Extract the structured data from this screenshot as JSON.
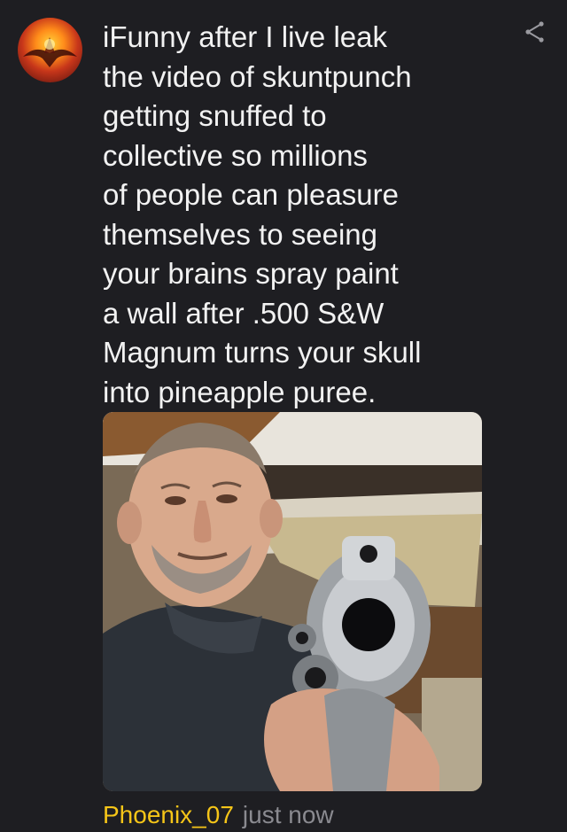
{
  "post": {
    "caption": "iFunny after I live leak\nthe video of skuntpunch\ngetting snuffed to\ncollective so millions\nof people can pleasure\nthemselves to seeing\nyour brains spray paint\na wall after .500 S&W\nMagnum turns your skull\ninto pineapple puree.",
    "username": "Phoenix_07",
    "timestamp": "just now"
  },
  "icons": {
    "share": "share-icon",
    "avatar": "phoenix-fire-avatar"
  },
  "colors": {
    "background": "#1e1e22",
    "text": "#f2f2f2",
    "username": "#f5c518",
    "timestamp": "#8a8a90"
  }
}
